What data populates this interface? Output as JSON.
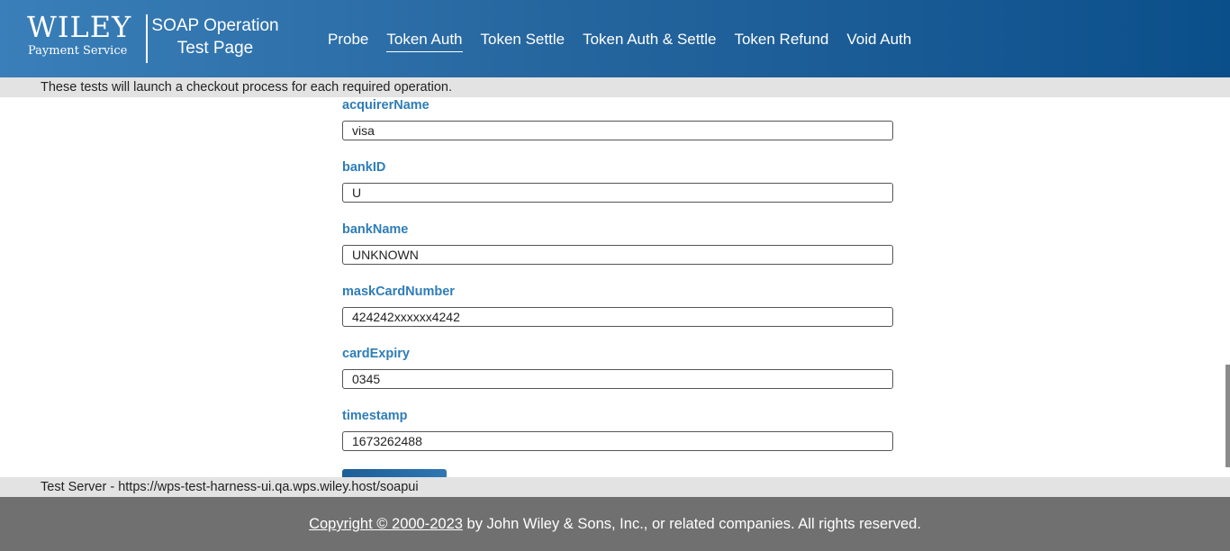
{
  "header": {
    "logo_word": "WILEY",
    "logo_sub": "Payment Service",
    "site_title_line1": "SOAP Operation",
    "site_title_line2": "Test Page",
    "nav": [
      {
        "label": "Probe",
        "active": false
      },
      {
        "label": "Token Auth",
        "active": true
      },
      {
        "label": "Token Settle",
        "active": false
      },
      {
        "label": "Token Auth & Settle",
        "active": false
      },
      {
        "label": "Token Refund",
        "active": false
      },
      {
        "label": "Void Auth",
        "active": false
      }
    ]
  },
  "info_bar": {
    "text": "These tests will launch a checkout process for each required operation."
  },
  "form": {
    "fields": [
      {
        "label": "acquirerName",
        "value": "visa"
      },
      {
        "label": "bankID",
        "value": "U"
      },
      {
        "label": "bankName",
        "value": "UNKNOWN"
      },
      {
        "label": "maskCardNumber",
        "value": "424242xxxxxx4242"
      },
      {
        "label": "cardExpiry",
        "value": "0345"
      },
      {
        "label": "timestamp",
        "value": "1673262488"
      }
    ]
  },
  "server_bar": {
    "text": "Test Server - https://wps-test-harness-ui.qa.wps.wiley.host/soapui"
  },
  "footer": {
    "copyright_link": "Copyright © 2000-2023",
    "copyright_rest": " by John Wiley & Sons, Inc., or related companies. All rights reserved."
  },
  "colors": {
    "header_start": "#3a7fb9",
    "header_end": "#0b4f8a",
    "label_blue": "#2e7db8",
    "bar_gray": "#e3e3e3",
    "footer_gray": "#707070"
  }
}
